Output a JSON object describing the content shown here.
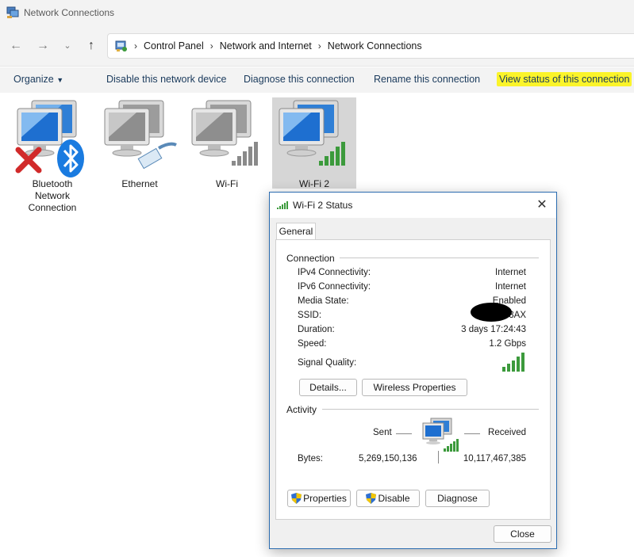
{
  "window": {
    "title": "Network Connections"
  },
  "breadcrumb": [
    "Control Panel",
    "Network and Internet",
    "Network Connections"
  ],
  "commands": {
    "organize": "Organize",
    "disable": "Disable this network device",
    "diagnose": "Diagnose this connection",
    "rename": "Rename this connection",
    "view_status": "View status of this connection"
  },
  "adapters": [
    {
      "name": "Bluetooth Network Connection",
      "state": "disconnected",
      "icon": "bluetooth-icon"
    },
    {
      "name": "Ethernet",
      "state": "cable",
      "icon": "ethernet-plug-icon"
    },
    {
      "name": "Wi-Fi",
      "state": "not-connected",
      "icon": "signal-bars-gray-icon"
    },
    {
      "name": "Wi-Fi 2",
      "state": "connected",
      "icon": "signal-bars-green-icon"
    }
  ],
  "dialog": {
    "title": "Wi-Fi 2 Status",
    "tab": "General",
    "connection_label": "Connection",
    "rows": [
      {
        "label": "IPv4 Connectivity:",
        "value": "Internet"
      },
      {
        "label": "IPv6 Connectivity:",
        "value": "Internet"
      },
      {
        "label": "Media State:",
        "value": "Enabled"
      },
      {
        "label": "SSID:",
        "value": "3AX"
      },
      {
        "label": "Duration:",
        "value": "3 days 17:24:43"
      },
      {
        "label": "Speed:",
        "value": "1.2 Gbps"
      }
    ],
    "signal_quality_label": "Signal Quality:",
    "details_button": "Details...",
    "wireless_button": "Wireless Properties",
    "activity_label": "Activity",
    "sent_label": "Sent",
    "received_label": "Received",
    "bytes_label": "Bytes:",
    "bytes_sent": "5,269,150,136",
    "bytes_received": "10,117,467,385",
    "properties_button": "Properties",
    "disable_button": "Disable",
    "diagnose_button": "Diagnose",
    "close_button": "Close"
  },
  "colors": {
    "highlight": "#fbf42a",
    "accent": "#2b6cb0",
    "signal_green": "#3c9a3c"
  }
}
